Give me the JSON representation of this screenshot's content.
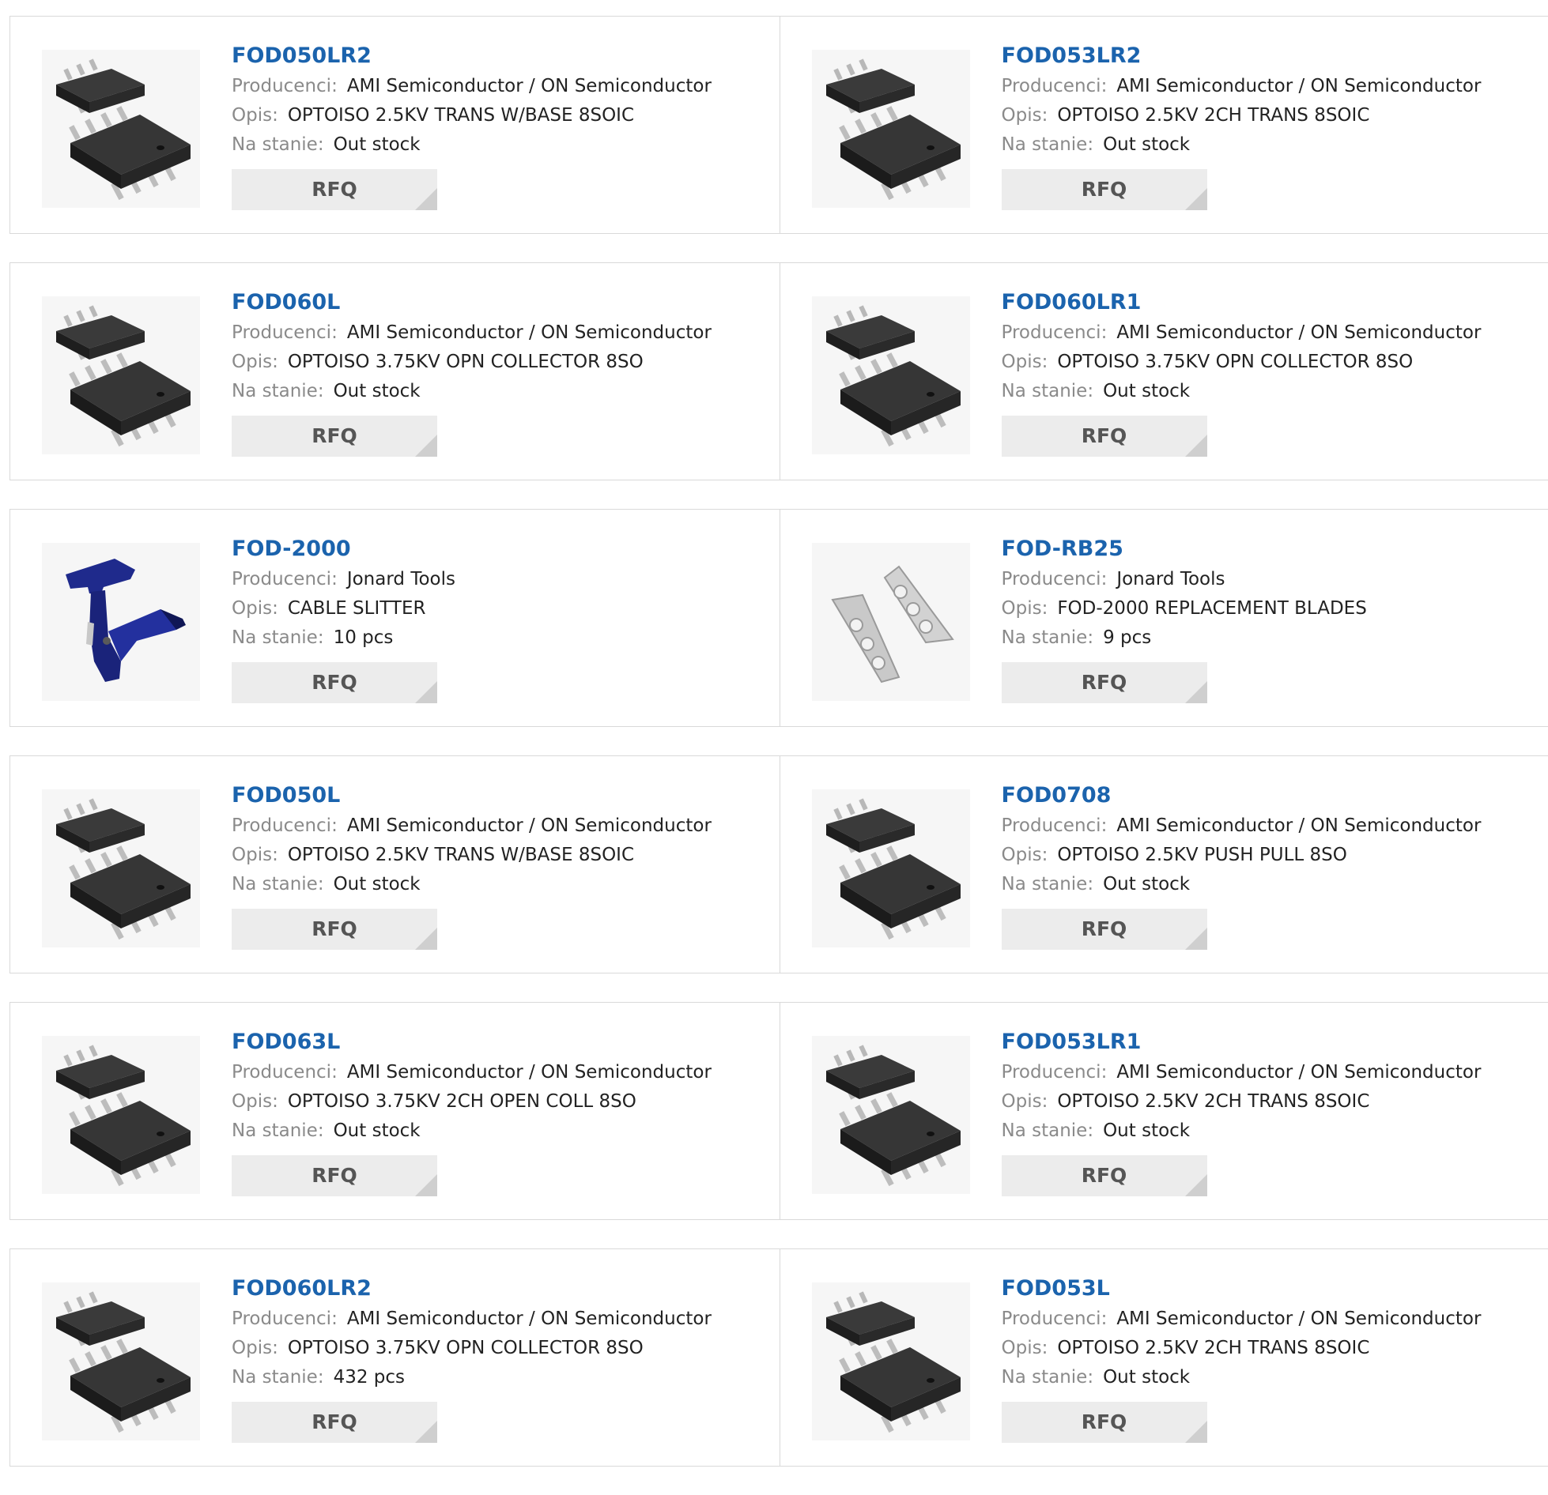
{
  "labels": {
    "manufacturer": "Producenci:",
    "description": "Opis:",
    "stock": "Na stanie:",
    "rfq": "RFQ"
  },
  "colors": {
    "link": "#1b63ad",
    "label": "#8a8a8a",
    "value": "#222222",
    "button_bg": "#ececec",
    "border": "#d9d9d9"
  },
  "products": [
    {
      "part": "FOD050LR2",
      "manufacturer": "AMI Semiconductor / ON Semiconductor",
      "description": "OPTOISO 2.5KV TRANS W/BASE 8SOIC",
      "stock": "Out stock",
      "image": "soic-8-chip-icon"
    },
    {
      "part": "FOD053LR2",
      "manufacturer": "AMI Semiconductor / ON Semiconductor",
      "description": "OPTOISO 2.5KV 2CH TRANS 8SOIC",
      "stock": "Out stock",
      "image": "soic-8-chip-icon"
    },
    {
      "part": "FOD060L",
      "manufacturer": "AMI Semiconductor / ON Semiconductor",
      "description": "OPTOISO 3.75KV OPN COLLECTOR 8SO",
      "stock": "Out stock",
      "image": "soic-8-chip-icon"
    },
    {
      "part": "FOD060LR1",
      "manufacturer": "AMI Semiconductor / ON Semiconductor",
      "description": "OPTOISO 3.75KV OPN COLLECTOR 8SO",
      "stock": "Out stock",
      "image": "soic-8-chip-icon"
    },
    {
      "part": "FOD-2000",
      "manufacturer": "Jonard Tools",
      "description": "CABLE SLITTER",
      "stock": "10 pcs",
      "image": "cable-slitter-icon"
    },
    {
      "part": "FOD-RB25",
      "manufacturer": "Jonard Tools",
      "description": "FOD-2000 REPLACEMENT BLADES",
      "stock": "9 pcs",
      "image": "replacement-blades-icon"
    },
    {
      "part": "FOD050L",
      "manufacturer": "AMI Semiconductor / ON Semiconductor",
      "description": "OPTOISO 2.5KV TRANS W/BASE 8SOIC",
      "stock": "Out stock",
      "image": "soic-8-chip-icon"
    },
    {
      "part": "FOD0708",
      "manufacturer": "AMI Semiconductor / ON Semiconductor",
      "description": "OPTOISO 2.5KV PUSH PULL 8SO",
      "stock": "Out stock",
      "image": "soic-8-chip-icon"
    },
    {
      "part": "FOD063L",
      "manufacturer": "AMI Semiconductor / ON Semiconductor",
      "description": "OPTOISO 3.75KV 2CH OPEN COLL 8SO",
      "stock": "Out stock",
      "image": "soic-8-chip-icon"
    },
    {
      "part": "FOD053LR1",
      "manufacturer": "AMI Semiconductor / ON Semiconductor",
      "description": "OPTOISO 2.5KV 2CH TRANS 8SOIC",
      "stock": "Out stock",
      "image": "soic-8-chip-icon"
    },
    {
      "part": "FOD060LR2",
      "manufacturer": "AMI Semiconductor / ON Semiconductor",
      "description": "OPTOISO 3.75KV OPN COLLECTOR 8SO",
      "stock": "432 pcs",
      "image": "soic-8-chip-icon"
    },
    {
      "part": "FOD053L",
      "manufacturer": "AMI Semiconductor / ON Semiconductor",
      "description": "OPTOISO 2.5KV 2CH TRANS 8SOIC",
      "stock": "Out stock",
      "image": "soic-8-chip-icon"
    }
  ]
}
